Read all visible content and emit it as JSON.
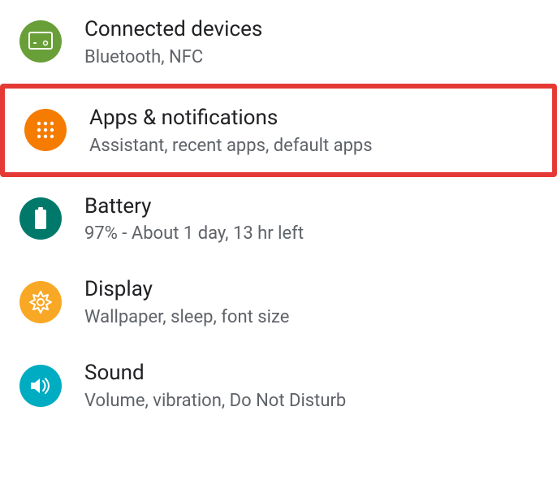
{
  "settings": {
    "items": [
      {
        "title": "Connected devices",
        "subtitle": "Bluetooth, NFC",
        "icon_color": "#689f38",
        "highlighted": false
      },
      {
        "title": "Apps & notifications",
        "subtitle": "Assistant, recent apps, default apps",
        "icon_color": "#f57c00",
        "highlighted": true
      },
      {
        "title": "Battery",
        "subtitle": "97% - About 1 day, 13 hr left",
        "icon_color": "#00796b",
        "highlighted": false
      },
      {
        "title": "Display",
        "subtitle": "Wallpaper, sleep, font size",
        "icon_color": "#f9a825",
        "highlighted": false
      },
      {
        "title": "Sound",
        "subtitle": "Volume, vibration, Do Not Disturb",
        "icon_color": "#00acc1",
        "highlighted": false
      }
    ]
  }
}
